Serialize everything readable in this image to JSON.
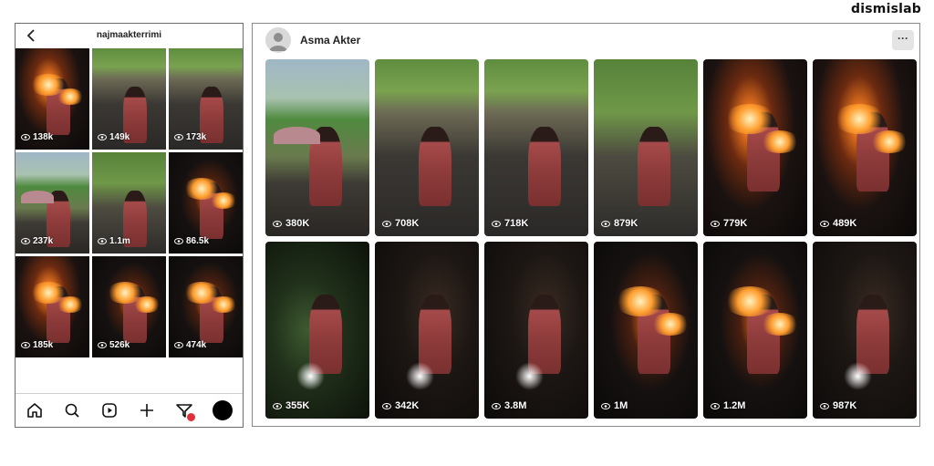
{
  "brand": "dismislab",
  "phone": {
    "username": "najmaakterrimi",
    "tiles": [
      {
        "views": "138k",
        "scene": "night-fire"
      },
      {
        "views": "149k",
        "scene": "day-ash"
      },
      {
        "views": "173k",
        "scene": "day-ash"
      },
      {
        "views": "237k",
        "scene": "day-field"
      },
      {
        "views": "1.1m",
        "scene": "day-forest"
      },
      {
        "views": "86.5k",
        "scene": "night-fire2"
      },
      {
        "views": "185k",
        "scene": "night-fire"
      },
      {
        "views": "526k",
        "scene": "night-fire2"
      },
      {
        "views": "474k",
        "scene": "night-fire2"
      }
    ],
    "nav": [
      "home-icon",
      "search-icon",
      "reels-icon",
      "add-icon",
      "activity-icon",
      "profile-avatar"
    ]
  },
  "panel": {
    "name": "Asma Akter",
    "more_label": "···",
    "tiles": [
      {
        "views": "380K",
        "scene": "day-field"
      },
      {
        "views": "708K",
        "scene": "day-ash"
      },
      {
        "views": "718K",
        "scene": "day-ash"
      },
      {
        "views": "879K",
        "scene": "day-forest"
      },
      {
        "views": "779K",
        "scene": "night-fire"
      },
      {
        "views": "489K",
        "scene": "night-fire"
      },
      {
        "views": "355K",
        "scene": "night-green"
      },
      {
        "views": "342K",
        "scene": "night-dark"
      },
      {
        "views": "3.8M",
        "scene": "night-dark"
      },
      {
        "views": "1M",
        "scene": "night-fire2"
      },
      {
        "views": "1.2M",
        "scene": "night-fire2"
      },
      {
        "views": "987K",
        "scene": "night-dark"
      }
    ]
  },
  "colors": {
    "badge": "#e0303b",
    "count_text": "#ffffff"
  }
}
